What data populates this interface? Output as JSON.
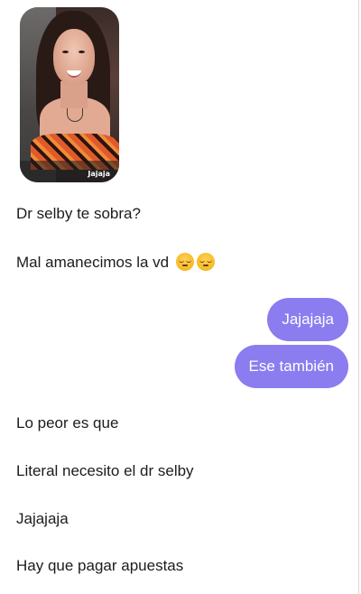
{
  "conversation": {
    "photo": {
      "caption": "Jajaja"
    },
    "messages": [
      {
        "direction": "in",
        "text": "Dr selby te sobra?"
      },
      {
        "direction": "in",
        "text": "Mal amanecimos la vd",
        "emoji": [
          "pensive-face",
          "pensive-face"
        ]
      },
      {
        "direction": "out",
        "text": "Jajajaja"
      },
      {
        "direction": "out",
        "text": "Ese también"
      },
      {
        "direction": "in",
        "text": "Lo peor es que"
      },
      {
        "direction": "in",
        "text": "Literal necesito el dr selby"
      },
      {
        "direction": "in",
        "text": "Jajajaja"
      },
      {
        "direction": "in",
        "text": "Hay que pagar apuestas"
      }
    ]
  },
  "colors": {
    "outgoing_bubble": "#8b7cf0",
    "outgoing_text": "#ffffff",
    "incoming_text": "#1c1c1e",
    "background": "#ffffff"
  }
}
